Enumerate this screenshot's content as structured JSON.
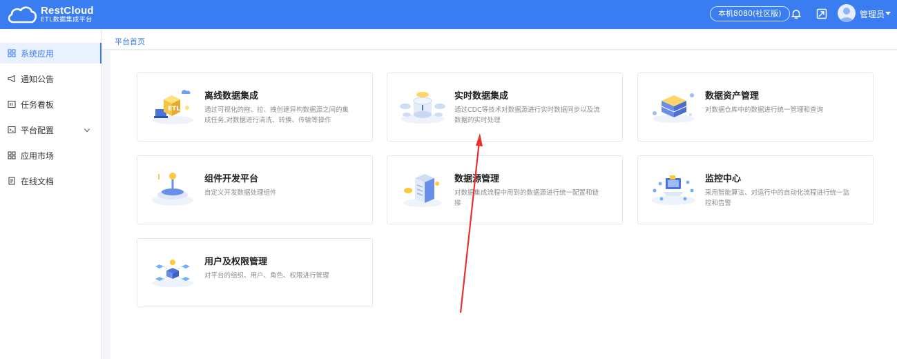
{
  "app": {
    "brand_title": "RestCloud",
    "brand_subtitle": "ETL数据集成平台",
    "environment": "本机8080(社区版)",
    "user_name": "管理员"
  },
  "sidebar": {
    "items": [
      {
        "label": "系统应用",
        "icon": "grid-icon",
        "active": true
      },
      {
        "label": "通知公告",
        "icon": "megaphone-icon"
      },
      {
        "label": "任务看板",
        "icon": "board-icon"
      },
      {
        "label": "平台配置",
        "icon": "terminal-icon",
        "has_submenu": true
      },
      {
        "label": "应用市场",
        "icon": "apps-icon"
      },
      {
        "label": "在线文档",
        "icon": "document-icon"
      }
    ]
  },
  "breadcrumb": {
    "current": "平台首页"
  },
  "cards": [
    {
      "title": "离线数据集成",
      "desc": "通过可视化的拖、拉、拽创建异构数据源之间的集成任务,对数据进行清洗、转换、传输等操作",
      "icon": "etl-illustration"
    },
    {
      "title": "实时数据集成",
      "desc": "通过CDC等技术对数据源进行实时数据同步以及流数据的实时处理",
      "icon": "realtime-illustration"
    },
    {
      "title": "数据资产管理",
      "desc": "对数据仓库中的数据进行统一管理和查询",
      "icon": "asset-illustration"
    },
    {
      "title": "组件开发平台",
      "desc": "自定义开发数据处理组件",
      "icon": "joystick-illustration"
    },
    {
      "title": "数据源管理",
      "desc": "对数据集成流程中用到的数据源进行统一配置和链接",
      "icon": "datasource-illustration"
    },
    {
      "title": "监控中心",
      "desc": "采用智能算法、对运行中的自动化流程进行统一监控和告警",
      "icon": "monitor-illustration"
    },
    {
      "title": "用户及权限管理",
      "desc": "对平台的组织、用户、角色、权限进行管理",
      "icon": "permission-illustration"
    }
  ],
  "colors": {
    "primary": "#3a7df0",
    "annotation_arrow": "#e8312f"
  }
}
